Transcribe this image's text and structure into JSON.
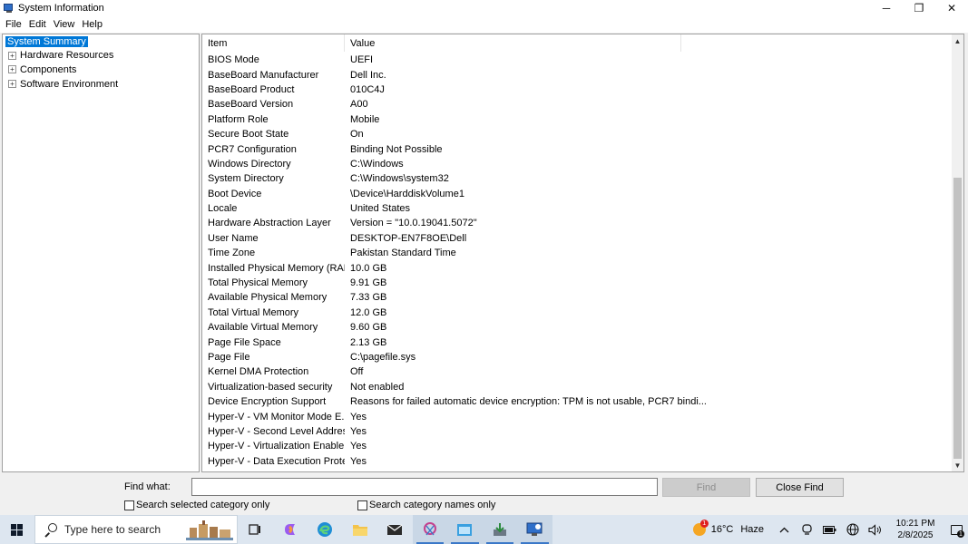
{
  "window": {
    "title": "System Information",
    "controls": {
      "minimize": "─",
      "restore": "❐",
      "close": "✕"
    }
  },
  "menu": [
    "File",
    "Edit",
    "View",
    "Help"
  ],
  "tree": {
    "root": "System Summary",
    "children": [
      {
        "label": "Hardware Resources",
        "expander": "+"
      },
      {
        "label": "Components",
        "expander": "+"
      },
      {
        "label": "Software Environment",
        "expander": "+"
      }
    ]
  },
  "list": {
    "columns": [
      "Item",
      "Value"
    ],
    "rows": [
      {
        "item": "BIOS Mode",
        "value": "UEFI"
      },
      {
        "item": "BaseBoard Manufacturer",
        "value": "Dell Inc."
      },
      {
        "item": "BaseBoard Product",
        "value": "010C4J"
      },
      {
        "item": "BaseBoard Version",
        "value": "A00"
      },
      {
        "item": "Platform Role",
        "value": "Mobile"
      },
      {
        "item": "Secure Boot State",
        "value": "On"
      },
      {
        "item": "PCR7 Configuration",
        "value": "Binding Not Possible"
      },
      {
        "item": "Windows Directory",
        "value": "C:\\Windows"
      },
      {
        "item": "System Directory",
        "value": "C:\\Windows\\system32"
      },
      {
        "item": "Boot Device",
        "value": "\\Device\\HarddiskVolume1"
      },
      {
        "item": "Locale",
        "value": "United States"
      },
      {
        "item": "Hardware Abstraction Layer",
        "value": "Version = \"10.0.19041.5072\""
      },
      {
        "item": "User Name",
        "value": "DESKTOP-EN7F8OE\\Dell"
      },
      {
        "item": "Time Zone",
        "value": "Pakistan Standard Time"
      },
      {
        "item": "Installed Physical Memory (RAM)",
        "value": "10.0 GB"
      },
      {
        "item": "Total Physical Memory",
        "value": "9.91 GB"
      },
      {
        "item": "Available Physical Memory",
        "value": "7.33 GB"
      },
      {
        "item": "Total Virtual Memory",
        "value": "12.0 GB"
      },
      {
        "item": "Available Virtual Memory",
        "value": "9.60 GB"
      },
      {
        "item": "Page File Space",
        "value": "2.13 GB"
      },
      {
        "item": "Page File",
        "value": "C:\\pagefile.sys"
      },
      {
        "item": "Kernel DMA Protection",
        "value": "Off"
      },
      {
        "item": "Virtualization-based security",
        "value": "Not enabled"
      },
      {
        "item": "Device Encryption Support",
        "value": "Reasons for failed automatic device encryption: TPM is not usable, PCR7 bindi..."
      },
      {
        "item": "Hyper-V - VM Monitor Mode E...",
        "value": "Yes"
      },
      {
        "item": "Hyper-V - Second Level Addres...",
        "value": "Yes"
      },
      {
        "item": "Hyper-V - Virtualization Enable...",
        "value": "Yes"
      },
      {
        "item": "Hyper-V - Data Execution Prote...",
        "value": "Yes"
      }
    ]
  },
  "find": {
    "label": "Find what:",
    "value": "",
    "find_button": "Find",
    "close_button": "Close Find",
    "check_selected": "Search selected category only",
    "check_names": "Search category names only"
  },
  "taskbar": {
    "search_placeholder": "Type here to search",
    "weather_temp": "16°C",
    "weather_desc": "Haze",
    "weather_badge": "1",
    "time": "10:21 PM",
    "date": "2/8/2025",
    "notification_count": "1",
    "apps": [
      "task-view",
      "copilot",
      "edge",
      "file-explorer",
      "mail",
      "snipping-tool",
      "app-window",
      "installer",
      "system-information"
    ]
  },
  "colors": {
    "selection": "#0078d7",
    "taskbar": "#dde6f0"
  }
}
